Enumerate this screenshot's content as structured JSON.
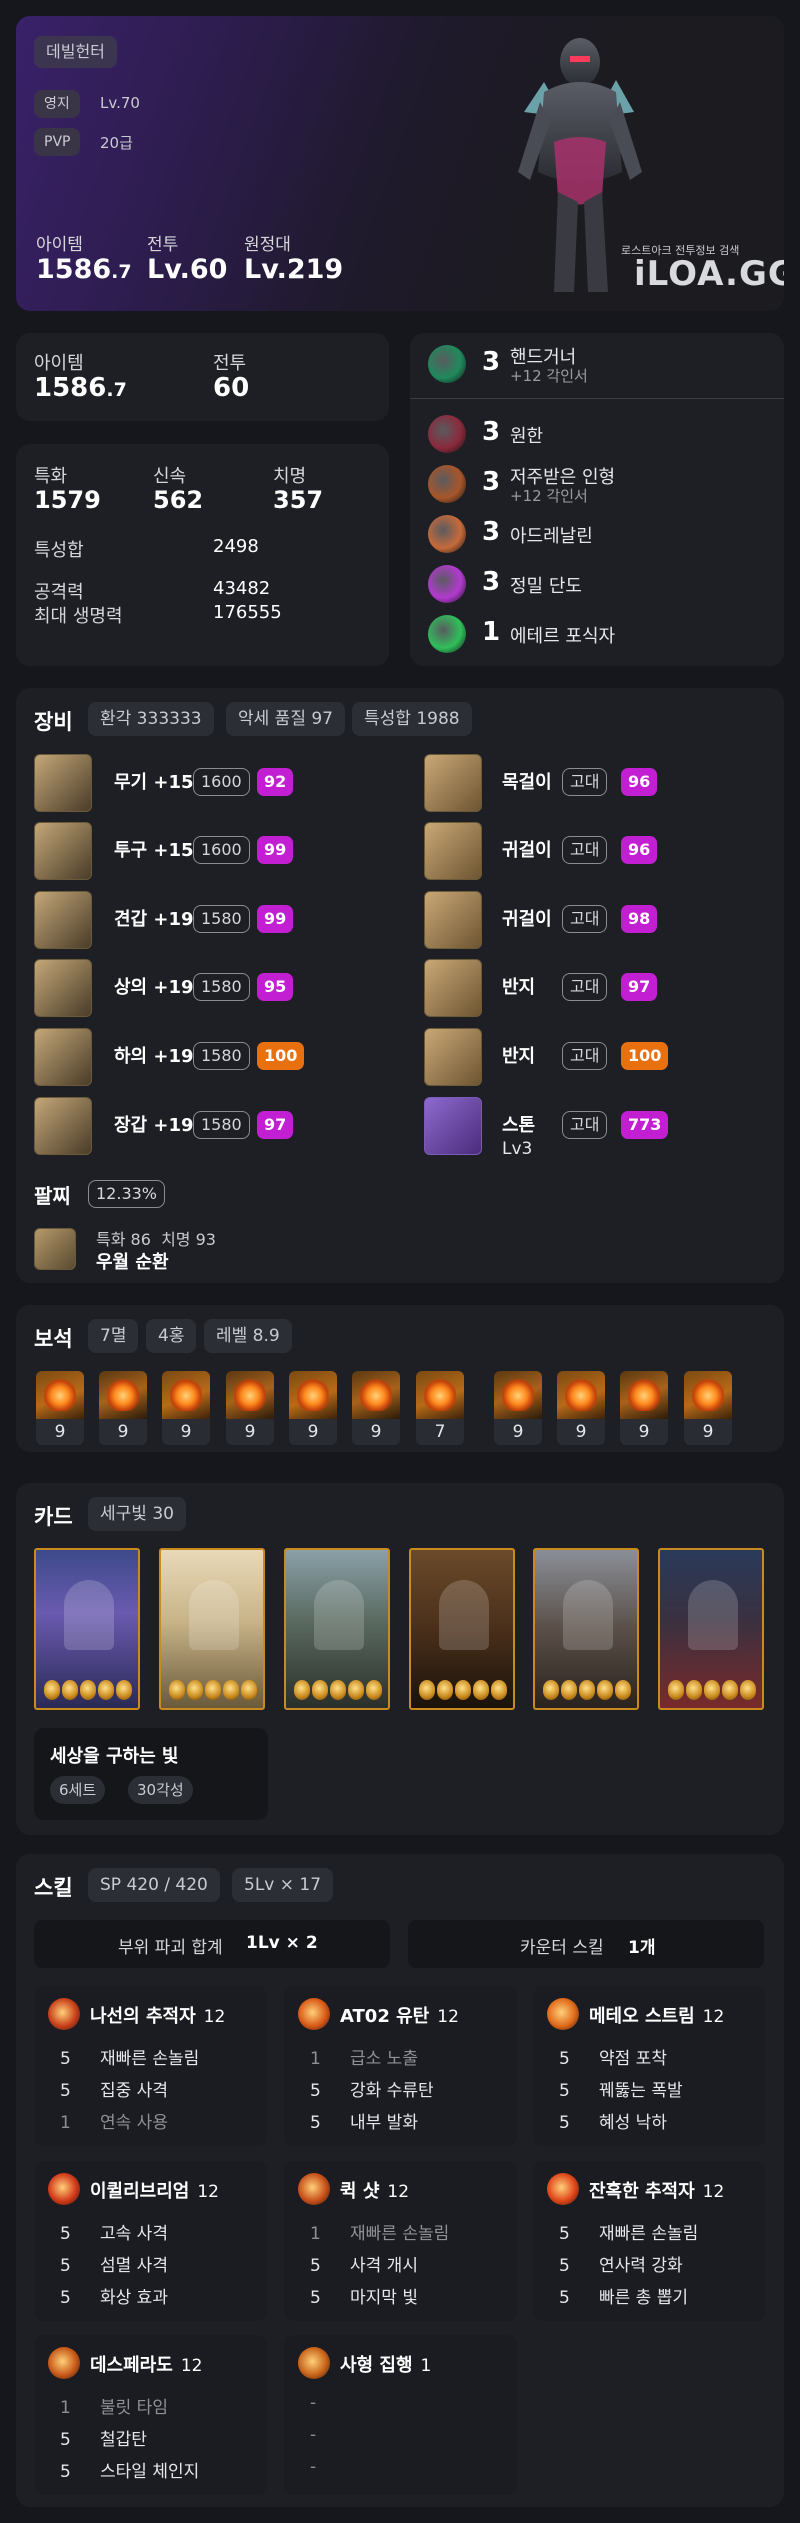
{
  "hero": {
    "class": "데빌헌터",
    "realm_label": "영지",
    "realm_value": "Lv.70",
    "pvp_label": "PVP",
    "pvp_value": "20급",
    "stats": [
      {
        "label": "아이템",
        "main": "1586",
        "dec": ".7"
      },
      {
        "label": "전투",
        "main": "Lv.60",
        "dec": ""
      },
      {
        "label": "원정대",
        "main": "Lv.219",
        "dec": ""
      }
    ],
    "watermark_small": "로스트아크 전투정보 검색",
    "watermark_logo": "iLOA.GG"
  },
  "summary": {
    "item_label": "아이템",
    "item_main": "1586",
    "item_dec": ".7",
    "combat_label": "전투",
    "combat_value": "60"
  },
  "stats": {
    "crit_label": "특화",
    "crit_value": "1579",
    "swift_label": "신속",
    "swift_value": "562",
    "spec_label": "치명",
    "spec_value": "357",
    "total_label": "특성합",
    "total_value": "2498",
    "atk_label": "공격력",
    "atk_value": "43482",
    "hp_label": "최대 생명력",
    "hp_value": "176555"
  },
  "engravings": [
    {
      "level": "3",
      "name": "핸드거너",
      "sub": "+12 각인서",
      "color": "#1f8a5c"
    },
    {
      "level": "3",
      "name": "원한",
      "sub": "",
      "color": "#8a2a3c"
    },
    {
      "level": "3",
      "name": "저주받은 인형",
      "sub": "+12 각인서",
      "color": "#a8562a"
    },
    {
      "level": "3",
      "name": "아드레날린",
      "sub": "",
      "color": "#c66a3a"
    },
    {
      "level": "3",
      "name": "정밀 단도",
      "sub": "",
      "color": "#b23ad0"
    },
    {
      "level": "1",
      "name": "에테르 포식자",
      "sub": "",
      "color": "#2fbf5a"
    }
  ],
  "equipment": {
    "title": "장비",
    "badges": [
      "환각 333333",
      "악세 품질 97",
      "특성합 1988"
    ],
    "left": [
      {
        "name": "무기 +15",
        "tier": "1600",
        "quality": "92",
        "qcolor": "purple"
      },
      {
        "name": "투구 +15",
        "tier": "1600",
        "quality": "99",
        "qcolor": "purple"
      },
      {
        "name": "견갑 +19",
        "tier": "1580",
        "quality": "99",
        "qcolor": "purple"
      },
      {
        "name": "상의 +19",
        "tier": "1580",
        "quality": "95",
        "qcolor": "purple"
      },
      {
        "name": "하의 +19",
        "tier": "1580",
        "quality": "100",
        "qcolor": "orange"
      },
      {
        "name": "장갑 +19",
        "tier": "1580",
        "quality": "97",
        "qcolor": "purple"
      }
    ],
    "right": [
      {
        "name": "목걸이",
        "tier": "고대",
        "quality": "96",
        "qcolor": "purple"
      },
      {
        "name": "귀걸이",
        "tier": "고대",
        "quality": "96",
        "qcolor": "purple"
      },
      {
        "name": "귀걸이",
        "tier": "고대",
        "quality": "98",
        "qcolor": "purple"
      },
      {
        "name": "반지",
        "tier": "고대",
        "quality": "97",
        "qcolor": "purple"
      },
      {
        "name": "반지",
        "tier": "고대",
        "quality": "100",
        "qcolor": "orange"
      },
      {
        "name": "스톤",
        "tier": "고대",
        "quality": "773",
        "qcolor": "purple",
        "extra": "Lv3"
      }
    ],
    "bracelet_title": "팔찌",
    "bracelet_pct": "12.33%",
    "bracelet_stat1": "특화 86",
    "bracelet_stat2": "치명 93",
    "bracelet_effect": "우월  순환"
  },
  "gems": {
    "title": "보석",
    "badges": [
      "7멸",
      "4홍",
      "레벨 8.9"
    ],
    "levels": [
      "9",
      "9",
      "9",
      "9",
      "9",
      "9",
      "7",
      "9",
      "9",
      "9",
      "9"
    ]
  },
  "cards": {
    "title": "카드",
    "badge": "세구빛 30",
    "set_name": "세상을 구하는 빛",
    "set_badges": [
      "6세트",
      "30각성"
    ],
    "awakening": [
      5,
      5,
      5,
      5,
      5,
      5
    ]
  },
  "skills": {
    "title": "스킬",
    "badges": [
      "SP 420 / 420",
      "5Lv × 17"
    ],
    "break_label": "부위 파괴 합계",
    "break_value": "1Lv × 2",
    "counter_label": "카운터 스킬",
    "counter_value": "1개",
    "list": [
      {
        "name": "나선의 추적자",
        "level": "12",
        "tripods": [
          [
            "5",
            "재빠른 손놀림"
          ],
          [
            "5",
            "집중 사격"
          ],
          [
            "1",
            "연속 사용"
          ]
        ],
        "dim": [
          false,
          false,
          true
        ]
      },
      {
        "name": "AT02 유탄",
        "level": "12",
        "tripods": [
          [
            "1",
            "급소 노출"
          ],
          [
            "5",
            "강화 수류탄"
          ],
          [
            "5",
            "내부 발화"
          ]
        ],
        "dim": [
          true,
          false,
          false
        ]
      },
      {
        "name": "메테오 스트림",
        "level": "12",
        "tripods": [
          [
            "5",
            "약점 포착"
          ],
          [
            "5",
            "꿰뚫는 폭발"
          ],
          [
            "5",
            "혜성 낙하"
          ]
        ],
        "dim": [
          false,
          false,
          false
        ]
      },
      {
        "name": "이퀼리브리엄",
        "level": "12",
        "tripods": [
          [
            "5",
            "고속 사격"
          ],
          [
            "5",
            "섬멸 사격"
          ],
          [
            "5",
            "화상 효과"
          ]
        ],
        "dim": [
          false,
          false,
          false
        ]
      },
      {
        "name": "퀵 샷",
        "level": "12",
        "tripods": [
          [
            "1",
            "재빠른 손놀림"
          ],
          [
            "5",
            "사격 개시"
          ],
          [
            "5",
            "마지막 빛"
          ]
        ],
        "dim": [
          true,
          false,
          false
        ]
      },
      {
        "name": "잔혹한 추적자",
        "level": "12",
        "tripods": [
          [
            "5",
            "재빠른 손놀림"
          ],
          [
            "5",
            "연사력 강화"
          ],
          [
            "5",
            "빠른 총 뽑기"
          ]
        ],
        "dim": [
          false,
          false,
          false
        ]
      },
      {
        "name": "데스페라도",
        "level": "12",
        "tripods": [
          [
            "1",
            "불릿 타임"
          ],
          [
            "5",
            "철갑탄"
          ],
          [
            "5",
            "스타일 체인지"
          ]
        ],
        "dim": [
          true,
          false,
          false
        ]
      },
      {
        "name": "사형 집행",
        "level": "1",
        "tripods": [
          [
            "-",
            ""
          ],
          [
            "-",
            ""
          ],
          [
            "-",
            ""
          ]
        ],
        "dim": [
          true,
          true,
          true
        ]
      }
    ]
  }
}
